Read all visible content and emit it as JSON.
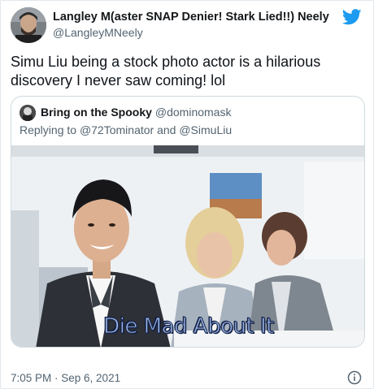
{
  "author": {
    "name": "Langley M(aster SNAP Denier! Stark Lied!!) Neely",
    "handle": "@LangleyMNeely"
  },
  "tweet": {
    "text": "Simu Liu being a stock photo actor is a hilarious discovery I never saw coming! lol"
  },
  "quoted": {
    "name": "Bring on the Spooky",
    "handle": "@dominomask",
    "reply_prefix": "Replying to",
    "reply_to_1": "@72Tominator",
    "reply_and": "and",
    "reply_to_2": "@SimuLiu",
    "image_caption": "Die Mad About It"
  },
  "meta": {
    "timestamp": "7:05 PM · Sep 6, 2021"
  },
  "icons": {
    "brand": "twitter-bird-icon",
    "info": "info-icon"
  },
  "colors": {
    "brand_blue": "#1d9bf0",
    "secondary_text": "#536471"
  }
}
